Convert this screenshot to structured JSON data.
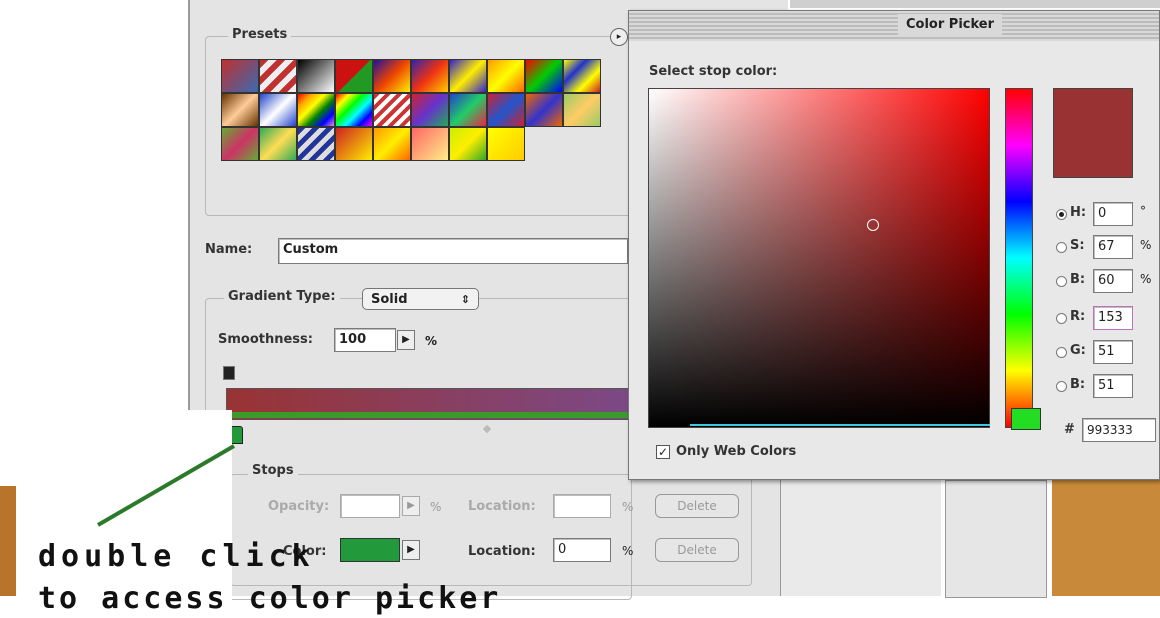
{
  "gradient_editor": {
    "presets_label": "Presets",
    "name_label": "Name:",
    "name_value": "Custom",
    "type_label": "Gradient Type:",
    "type_value": "Solid",
    "smoothness_label": "Smoothness:",
    "smoothness_value": "100",
    "smoothness_unit": "%",
    "stops_label": "Stops",
    "opacity_label": "Opacity:",
    "opacity_unit": "%",
    "location_label": "Location:",
    "location_unit": "%",
    "delete_label": "Delete",
    "color_label": "Color:",
    "color_location_value": "0",
    "stop_color": "#22993a",
    "gradient_start_color": "#993333",
    "gradient_end_color": "#7a4a8a",
    "presets": [
      "linear-gradient(135deg,#c03030,#3a6ab0)",
      "repeating-linear-gradient(135deg,#c03030 0 6px,#eee 6px 12px)",
      "linear-gradient(135deg,#000,#fff)",
      "linear-gradient(135deg,#cc1111 50%,#229922 50%)",
      "linear-gradient(135deg,#221199,#ee4400,#ffee00)",
      "linear-gradient(135deg,#3322aa,#ee3311,#ffcc00)",
      "linear-gradient(135deg,#3322cc,#ffee00,#3322cc)",
      "linear-gradient(135deg,#ff9900,#ffff00,#ff6600)",
      "linear-gradient(135deg,#ff0000,#00cc00,#0000ff)",
      "linear-gradient(135deg,#ffff00,#2233cc,#ffff00,#cc2222)",
      "linear-gradient(135deg,#663300,#ffcc99,#663300)",
      "linear-gradient(135deg,#2244cc,#ffffff,#2244cc)",
      "linear-gradient(135deg,red,orange,yellow,green,blue,violet)",
      "linear-gradient(135deg,red,yellow,lime,cyan,blue,magenta)",
      "repeating-linear-gradient(135deg,#cc3333 0 4px,#fff 4px 8px)",
      "linear-gradient(135deg,#cc2233,#6633cc,#22aa55)",
      "linear-gradient(135deg,#2244cc,#22cc66,#ee2244)",
      "linear-gradient(135deg,#cc2233,#2255cc,#cc2233)",
      "linear-gradient(135deg,#ee6600,#3333cc,#ee6600)",
      "linear-gradient(135deg,#99cc66,#ffcc66,#99cc66)",
      "linear-gradient(135deg,#66aa33,#cc3366,#66aa33)",
      "linear-gradient(135deg,#33aa55,#ffdd55,#33aa55)",
      "repeating-linear-gradient(135deg,#223399 0 5px,#ddd 5px 10px)",
      "linear-gradient(135deg,#cc2222,#ffee00)",
      "linear-gradient(135deg,#ff9900,#ffee00,#ff6600)",
      "linear-gradient(135deg,#ff6666,#ffee88)",
      "linear-gradient(135deg,#ccee00,#ffee00,#33aa22)",
      "linear-gradient(135deg,#ffff00,#ffcc00)"
    ]
  },
  "color_picker": {
    "title": "Color Picker",
    "select_label": "Select stop color:",
    "selected_color": "#993333",
    "h_label": "H:",
    "h_value": "0",
    "h_unit": "°",
    "s_label": "S:",
    "s_value": "67",
    "s_unit": "%",
    "b_label": "B:",
    "b_value": "60",
    "b_unit": "%",
    "r_label": "R:",
    "r_value": "153",
    "g_label": "G:",
    "g_value": "51",
    "b2_label": "B:",
    "b2_value": "51",
    "hex_label": "#",
    "hex_value": "993333",
    "web_colors_label": "Only Web Colors",
    "web_colors_checked": true
  },
  "annotation": {
    "line1": "double click",
    "line2": "to access color picker",
    "color": "#111111"
  }
}
